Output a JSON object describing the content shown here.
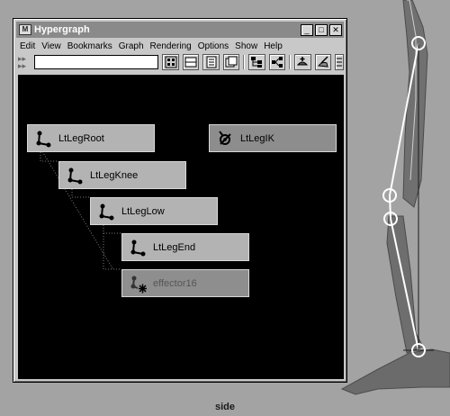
{
  "viewport": {
    "label": "side"
  },
  "window": {
    "title": "Hypergraph",
    "controls": [
      "_",
      "□",
      "✕"
    ]
  },
  "menu": [
    "Edit",
    "View",
    "Bookmarks",
    "Graph",
    "Rendering",
    "Options",
    "Show",
    "Help"
  ],
  "toolbar": {
    "search_value": "",
    "buttons": [
      "scene-hierarchy-icon",
      "expand-icon",
      "layout-icon",
      "frame-all-icon",
      "dependency-graph-icon",
      "connections-icon",
      "add-bookmark-icon",
      "graph-edit-icon",
      "more-icon"
    ]
  },
  "graph": {
    "nodes": [
      {
        "label": "LtLegRoot",
        "type": "joint"
      },
      {
        "label": "LtLegKnee",
        "type": "joint"
      },
      {
        "label": "LtLegLow",
        "type": "joint"
      },
      {
        "label": "LtLegEnd",
        "type": "joint"
      },
      {
        "label": "effector16",
        "type": "effector",
        "state": "inactive"
      },
      {
        "label": "LtLegIK",
        "type": "ik-handle"
      }
    ]
  }
}
